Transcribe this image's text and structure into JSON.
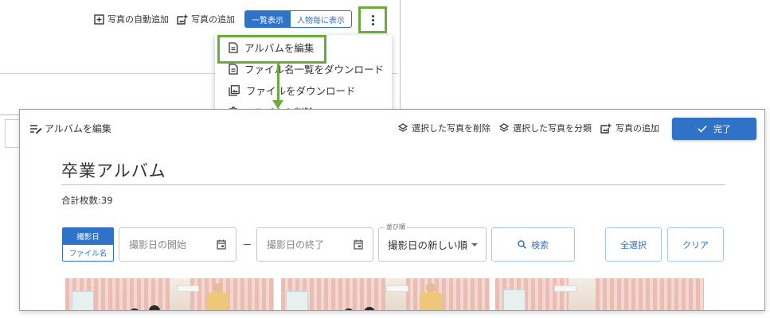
{
  "colors": {
    "highlight": "#6aab3c",
    "accent": "#2f73c9"
  },
  "screen1": {
    "toolbar": [
      {
        "icon": "add-box-icon",
        "label": "写真の自動追加"
      },
      {
        "icon": "add-photo-icon",
        "label": "写真の追加"
      }
    ],
    "view_toggle": {
      "list": "一覧表示",
      "by_person": "人物毎に表示",
      "selected": "一覧表示"
    },
    "more_icon": "more-vert-icon",
    "menu": [
      {
        "icon": "document-icon",
        "label": "アルバムを編集"
      },
      {
        "icon": "document-icon",
        "label": "ファイル名一覧をダウンロード"
      },
      {
        "icon": "photo-library-icon",
        "label": "ファイルをダウンロード"
      },
      {
        "icon": "trash-icon",
        "label": "アルバムを削除"
      }
    ]
  },
  "screen2": {
    "header": {
      "title_icon": "edit-list-icon",
      "title": "アルバムを編集"
    },
    "actions": [
      {
        "icon": "layers-icon",
        "label": "選択した写真を削除"
      },
      {
        "icon": "layers-icon",
        "label": "選択した写真を分類"
      },
      {
        "icon": "add-photo-icon",
        "label": "写真の追加"
      }
    ],
    "done": {
      "icon": "check-icon",
      "label": "完了"
    },
    "album_name": "卒業アルバム",
    "total": {
      "label": "合計枚数:",
      "count": "39"
    },
    "sort_key": {
      "date": "撮影日",
      "filename": "ファイル名",
      "selected": "撮影日"
    },
    "date_start": {
      "placeholder": "撮影日の開始",
      "icon": "calendar-icon"
    },
    "date_end": {
      "placeholder": "撮影日の終了",
      "icon": "calendar-icon"
    },
    "order": {
      "label": "並び順",
      "value": "撮影日の新しい順"
    },
    "search_button": {
      "icon": "search-icon",
      "label": "検索"
    },
    "select_all": "全選択",
    "clear": "クリア"
  }
}
